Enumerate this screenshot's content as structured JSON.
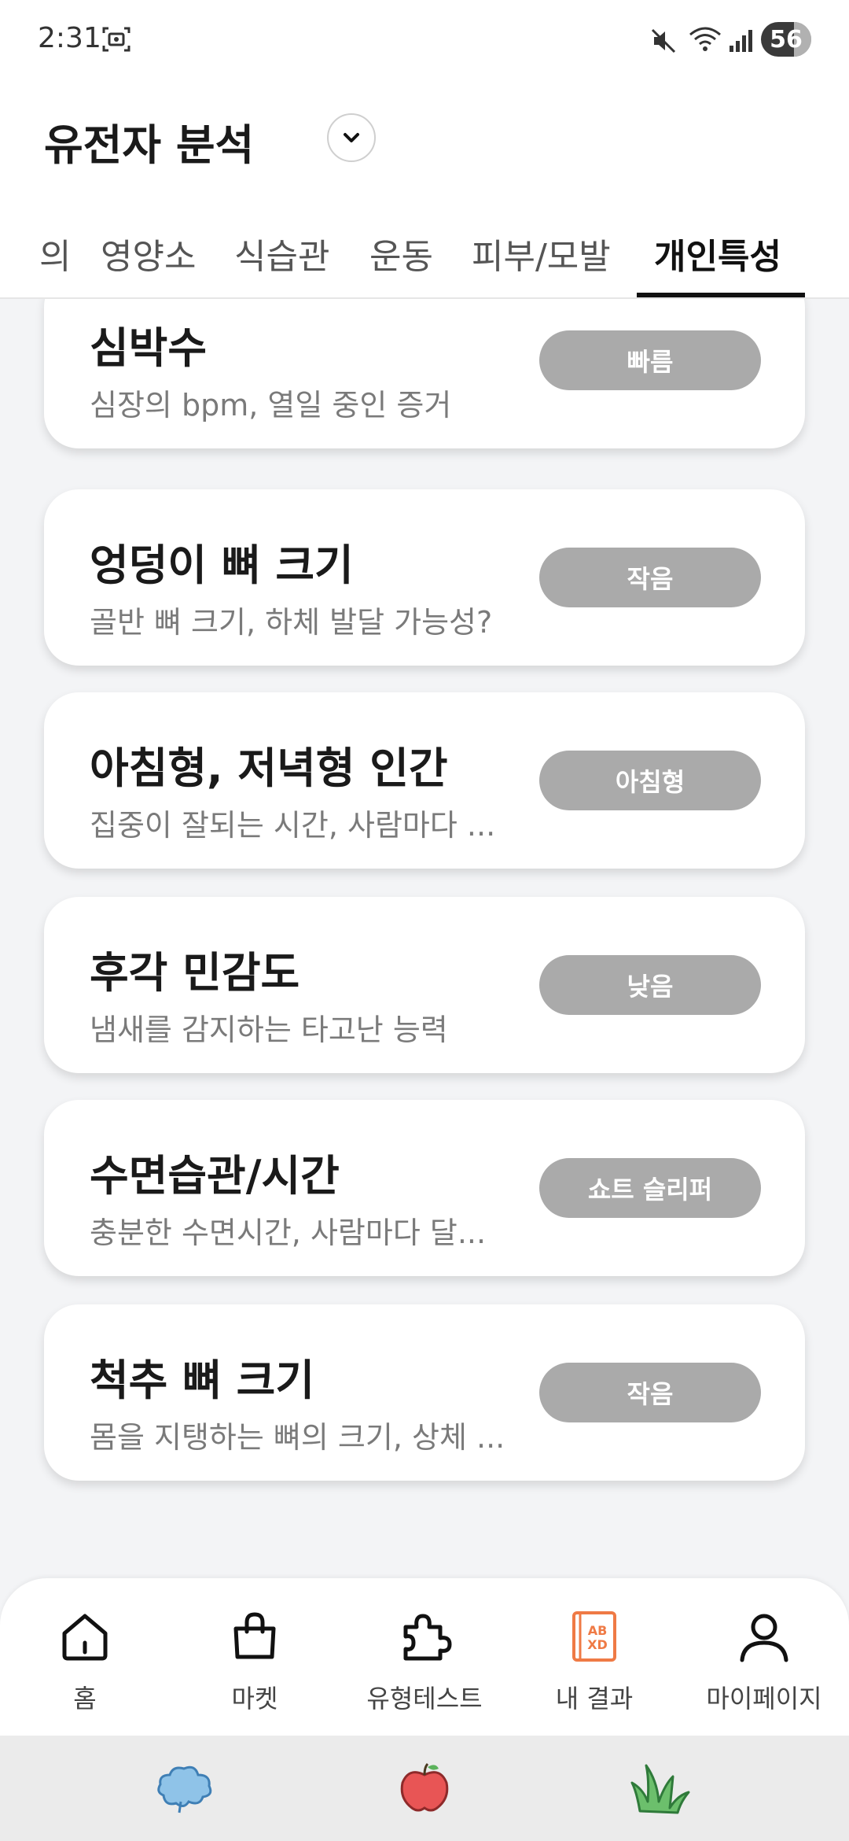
{
  "status_bar": {
    "time": "2:31",
    "battery": "56",
    "icons": [
      "screenshot-icon",
      "mute-icon",
      "wifi-icon",
      "signal-icon",
      "battery-icon"
    ]
  },
  "header": {
    "title": "유전자 분석",
    "dropdown_icon": "chevron-down-icon",
    "tabs": [
      {
        "label": "의"
      },
      {
        "label": "영양소"
      },
      {
        "label": "식습관"
      },
      {
        "label": "운동"
      },
      {
        "label": "피부/모발"
      },
      {
        "label": "개인특성",
        "active": true
      }
    ]
  },
  "cards": [
    {
      "title": "심박수",
      "description": "심장의 bpm, 열일 중인 증거",
      "badge": "빠름"
    },
    {
      "title": "엉덩이 뼈 크기",
      "description": "골반 뼈 크기, 하체 발달 가능성?",
      "badge": "작음"
    },
    {
      "title": "아침형, 저녁형 인간",
      "description": "집중이 잘되는 시간, 사람마다 ...",
      "badge": "아침형"
    },
    {
      "title": "후각 민감도",
      "description": "냄새를 감지하는 타고난 능력",
      "badge": "낮음"
    },
    {
      "title": "수면습관/시간",
      "description": "충분한 수면시간, 사람마다 달...",
      "badge": "쇼트 슬리퍼"
    },
    {
      "title": "척추 뼈 크기",
      "description": "몸을 지탱하는 뼈의 크기, 상체 ...",
      "badge": "작음"
    }
  ],
  "colors": {
    "accent_orange": "#ef7a45",
    "badge_gray": "#aaaaaa",
    "background": "#f3f4f6"
  },
  "bottom_nav": [
    {
      "label": "홈",
      "icon": "home-icon"
    },
    {
      "label": "마켓",
      "icon": "shopping-bag-icon"
    },
    {
      "label": "유형테스트",
      "icon": "puzzle-icon"
    },
    {
      "label": "내 결과",
      "icon": "result-book-icon",
      "active": true
    },
    {
      "label": "마이페이지",
      "icon": "user-icon"
    }
  ],
  "system_bar": {
    "stickers": [
      "cloud-sticker-icon",
      "apple-sticker-icon",
      "grass-sticker-icon"
    ]
  }
}
